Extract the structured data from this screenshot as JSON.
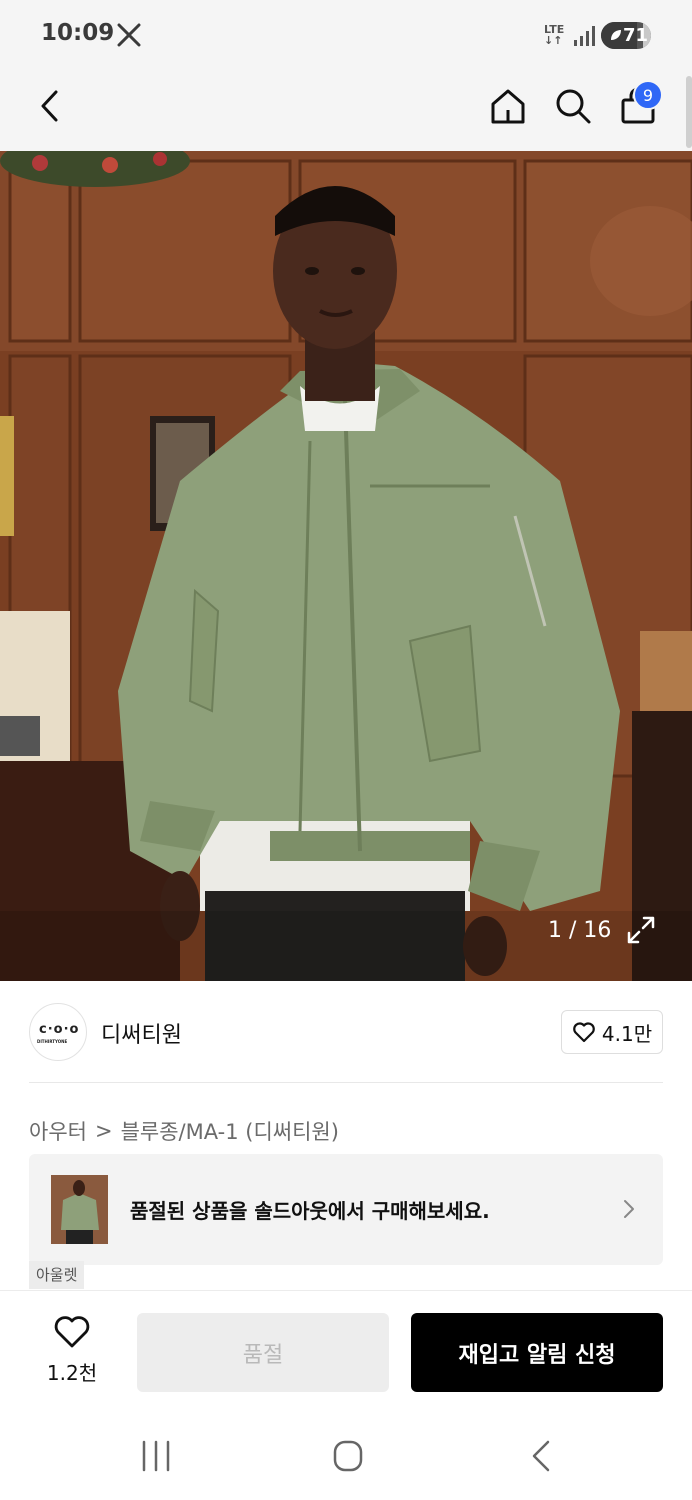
{
  "status_bar": {
    "time": "10:09",
    "network_top": "LTE",
    "network_bottom": "↓↑",
    "battery": "71",
    "battery_level": 0.71,
    "icons": [
      "x-logo-icon",
      "signal-icon",
      "battery-icon"
    ]
  },
  "header": {
    "icons": [
      "back-arrow-icon",
      "home-icon",
      "search-icon",
      "shopping-bag-icon"
    ],
    "cart_count": "9"
  },
  "product_image": {
    "counter": "1 / 16"
  },
  "brand": {
    "logo_text": "ᴄ·ᴏ·ᴏ",
    "logo_subtext": "DITHIRTYONE",
    "name": "디써티원",
    "likes": "4.1만"
  },
  "breadcrumb": {
    "category": "아우터",
    "separator": ">",
    "subcategory": "블루종/MA-1 (디써티원)"
  },
  "soldout_banner": {
    "text": "품절된 상품을 솔드아웃에서 구매해보세요.",
    "tag": "아울렛"
  },
  "bottom_bar": {
    "wish_count": "1.2천",
    "soldout_label": "품절",
    "restock_label": "재입고 알림 신청"
  },
  "colors": {
    "accent": "#2f67f6",
    "primary_button": "#000000",
    "disabled_button": "#ededed"
  }
}
